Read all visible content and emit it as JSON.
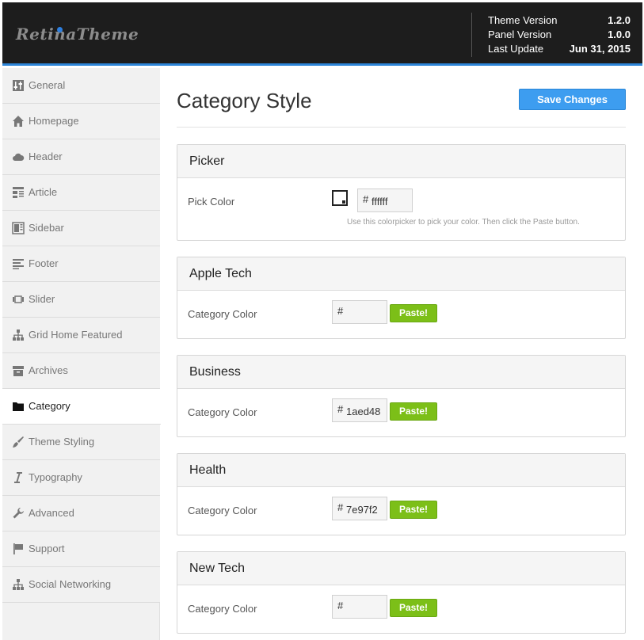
{
  "header": {
    "logo": "RetinaTheme",
    "theme_version_label": "Theme Version",
    "theme_version": "1.2.0",
    "panel_version_label": "Panel Version",
    "panel_version": "1.0.0",
    "last_update_label": "Last Update",
    "last_update": "Jun 31, 2015",
    "accent_color": "#2d85d8"
  },
  "sidebar": {
    "items": [
      {
        "label": "General",
        "icon": "sliders-icon"
      },
      {
        "label": "Homepage",
        "icon": "home-icon"
      },
      {
        "label": "Header",
        "icon": "cloud-icon"
      },
      {
        "label": "Article",
        "icon": "article-layout-icon"
      },
      {
        "label": "Sidebar",
        "icon": "sidebar-layout-icon"
      },
      {
        "label": "Footer",
        "icon": "footer-lines-icon"
      },
      {
        "label": "Slider",
        "icon": "slider-icon"
      },
      {
        "label": "Grid Home Featured",
        "icon": "sitemap-icon"
      },
      {
        "label": "Archives",
        "icon": "archive-box-icon"
      },
      {
        "label": "Category",
        "icon": "folder-icon",
        "active": true
      },
      {
        "label": "Theme Styling",
        "icon": "brush-icon"
      },
      {
        "label": "Typography",
        "icon": "italic-icon"
      },
      {
        "label": "Advanced",
        "icon": "wrench-icon"
      },
      {
        "label": "Support",
        "icon": "flag-icon"
      },
      {
        "label": "Social Networking",
        "icon": "network-icon"
      }
    ]
  },
  "main": {
    "title": "Category Style",
    "save_label": "Save Changes",
    "save_color": "#3d9df0",
    "picker": {
      "heading": "Picker",
      "label": "Pick Color",
      "hash": "#",
      "value": "ffffff",
      "hint": "Use this colorpicker to pick your color. Then click the Paste button."
    },
    "categories": [
      {
        "heading": "Apple Tech",
        "label": "Category Color",
        "hash": "#",
        "value": "",
        "paste": "Paste!"
      },
      {
        "heading": "Business",
        "label": "Category Color",
        "hash": "#",
        "value": "1aed48",
        "paste": "Paste!"
      },
      {
        "heading": "Health",
        "label": "Category Color",
        "hash": "#",
        "value": "7e97f2",
        "paste": "Paste!"
      },
      {
        "heading": "New Tech",
        "label": "Category Color",
        "hash": "#",
        "value": "",
        "paste": "Paste!"
      }
    ],
    "paste_color": "#7cbf18"
  }
}
